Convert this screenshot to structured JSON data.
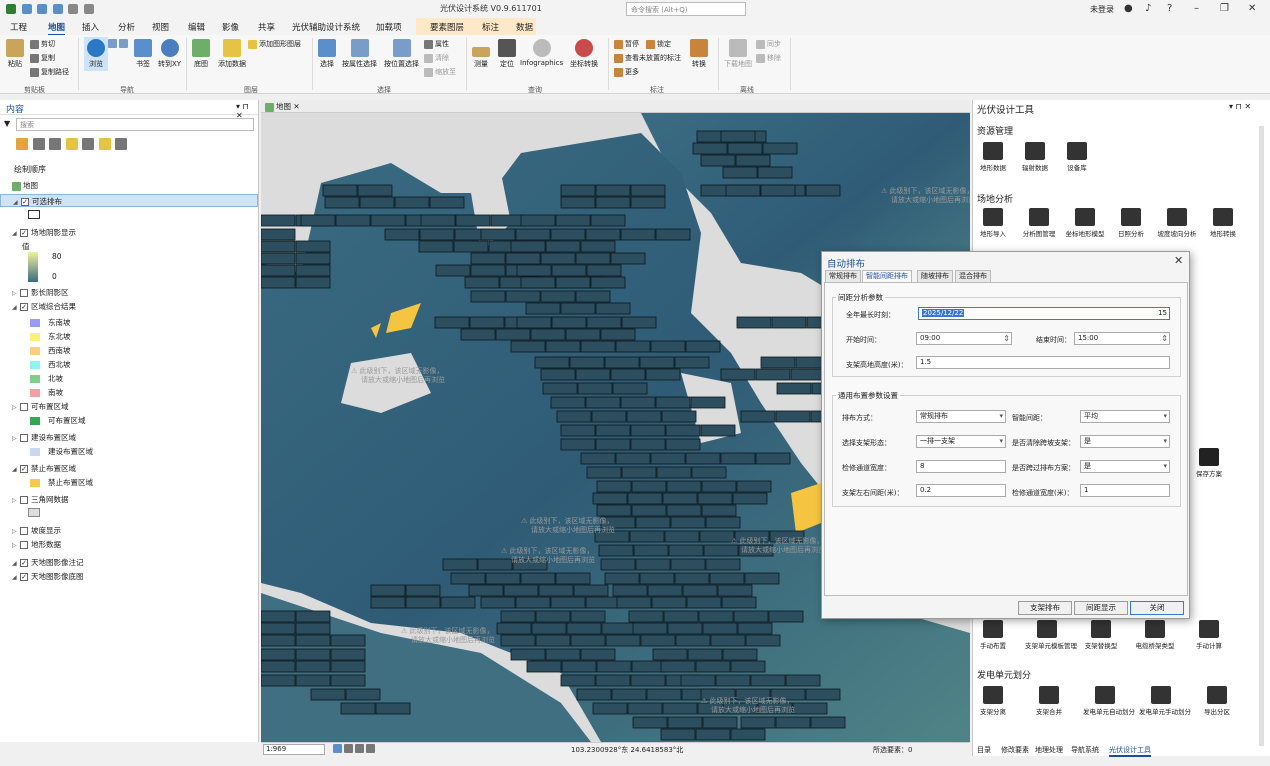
{
  "app": {
    "title": "光伏设计系统 V0.9.611701",
    "search_placeholder": "命令搜索 (Alt+Q)",
    "login": "未登录",
    "login_icon": "user-icon",
    "bell_icon": "bell-icon",
    "help": "?"
  },
  "ribbon_tabs": [
    "工程",
    "地图",
    "插入",
    "分析",
    "视图",
    "编辑",
    "影像",
    "共享",
    "光伏辅助设计系统",
    "加载项",
    "要素图层",
    "标注",
    "数据"
  ],
  "active_tab": "地图",
  "ribbon": {
    "clipboard": {
      "paste": "粘贴",
      "cut": "剪切",
      "copy": "复制",
      "copy_path": "复制路径",
      "group": "剪贴板"
    },
    "navigate": {
      "explore": "浏览",
      "bookmark": "书签",
      "goto": "转到XY",
      "group": "导航"
    },
    "layer": {
      "basemap": "底图",
      "add_data": "添加数据",
      "add_shapes": "添加图形图层",
      "group": "图层"
    },
    "selection": {
      "select": "选择",
      "by_attr": "按属性选择",
      "by_loc": "按位置选择",
      "attributes": "属性",
      "clear": "清除",
      "zoom_to": "缩放至",
      "group": "选择"
    },
    "inquiry": {
      "measure": "测量",
      "locate": "定位",
      "infographics": "Infographics",
      "coords": "坐标转换",
      "group": "查询"
    },
    "labeling": {
      "pause": "暂停",
      "lock": "锁定",
      "view_unplaced": "查看未放置的标注",
      "more": "更多",
      "convert": "转换",
      "group": "标注"
    },
    "offline": {
      "download": "下载地图",
      "sync": "同步",
      "remove": "移除",
      "group": "离线"
    }
  },
  "contents": {
    "title": "内容",
    "search_placeholder": "搜索",
    "drawing_order": "绘制顺序",
    "map": "地图",
    "layers": [
      {
        "label": "可选排布",
        "checked": true,
        "selected": true
      },
      {
        "label": "场地阴影显示",
        "checked": true
      },
      {
        "label": "值",
        "checked": null
      },
      {
        "label": "80",
        "checked": null
      },
      {
        "label": "0",
        "checked": null
      },
      {
        "label": "影长阴影区",
        "checked": false
      },
      {
        "label": "区域综合结果",
        "checked": true
      },
      {
        "label": "东南坡",
        "color": "#9a9af2"
      },
      {
        "label": "东北坡",
        "color": "#f6f27a"
      },
      {
        "label": "西南坡",
        "color": "#f7d27a"
      },
      {
        "label": "西北坡",
        "color": "#8ff3f0"
      },
      {
        "label": "北坡",
        "color": "#7fcf8a"
      },
      {
        "label": "南坡",
        "color": "#f2a0a0"
      },
      {
        "label": "可布置区域",
        "checked": false
      },
      {
        "label": "可布置区域",
        "color": "#33a852"
      },
      {
        "label": "建设布置区域",
        "checked": false
      },
      {
        "label": "建设布置区域",
        "color": "#c8d8f0"
      },
      {
        "label": "禁止布置区域",
        "checked": true
      },
      {
        "label": "禁止布置区域",
        "color": "#f7c94a"
      },
      {
        "label": "三角网数据",
        "checked": false
      },
      {
        "label": "坡度显示",
        "checked": false
      },
      {
        "label": "地形数据",
        "checked": false
      },
      {
        "label": "天地图影像注记",
        "checked": true
      },
      {
        "label": "天地图影像底图",
        "checked": true
      }
    ]
  },
  "map": {
    "tab": "地图",
    "watermark_line1": "此级别下，该区域无影像，",
    "watermark_line2": "请放大或缩小地图后再浏览",
    "scale": "1:969",
    "coords": "103.2300928°东 24.6418583°北",
    "selected_features": "所选要素：0",
    "colors": {
      "terrain_dark": "#2f5b76",
      "terrain_mid": "#5b8a8e",
      "terrain_light": "#a9c990",
      "forbidden": "#f5c542"
    }
  },
  "right_panel": {
    "title": "光伏设计工具",
    "sections": {
      "resource": "资源管理",
      "site": "场地分析",
      "unit": "发电单元划分"
    },
    "resource_tools": [
      "地形数据",
      "辐射数据",
      "设备库"
    ],
    "site_tools": [
      "地形导入",
      "分析图管理",
      "坐标地形模型",
      "日照分析",
      "坡度坡向分析",
      "地形转换"
    ],
    "save_tool": "保存方案",
    "layout_tools": [
      "手动布置",
      "支架单元模板管理",
      "支架替换型",
      "电缆桥架类型",
      "手动计算"
    ],
    "unit_tools": [
      "支架分离",
      "支架合并",
      "发电单元自动划分",
      "发电单元手动划分",
      "导出分区"
    ],
    "bottom_tabs": [
      "目录",
      "修改要素",
      "地理处理",
      "导航系统",
      "光伏设计工具"
    ]
  },
  "dialog": {
    "title": "自动排布",
    "tabs": [
      "常规排布",
      "智能间距排布",
      "随坡排布",
      "混合排布"
    ],
    "active_tab": "智能间距排布",
    "group1": "间距分析参数",
    "year_shortest_label": "全年最长时刻：",
    "year_shortest_value": "2025/12/22",
    "start_time_label": "开始时间：",
    "start_time_value": "09:00",
    "end_time_label": "结束时间：",
    "end_time_value": "15:00",
    "height_label": "支架高地高度(米)：",
    "height_value": "1.5",
    "group2": "通用布置参数设置",
    "layout_mode_label": "排布方式：",
    "layout_mode_value": "常规排布",
    "smart_spacing_label": "智能间距：",
    "smart_spacing_value": "平均",
    "support_form_label": "选择支架形态：",
    "support_form_value": "一排一支架",
    "cross_slope_label": "是否清除跨坡支架：",
    "cross_slope_value": "是",
    "aisle_width_label": "检修通道宽度：",
    "aisle_width_value": "8",
    "same_row_label": "是否跨过排布方案：",
    "same_row_value": "是",
    "lr_gap_label": "支架左右间距(米)：",
    "lr_gap_value": "0.2",
    "maint_width_label": "检修通道宽度(米)：",
    "maint_width_value": "1",
    "buttons": {
      "layout": "支架排布",
      "spacing": "间距显示",
      "close": "关闭"
    }
  }
}
